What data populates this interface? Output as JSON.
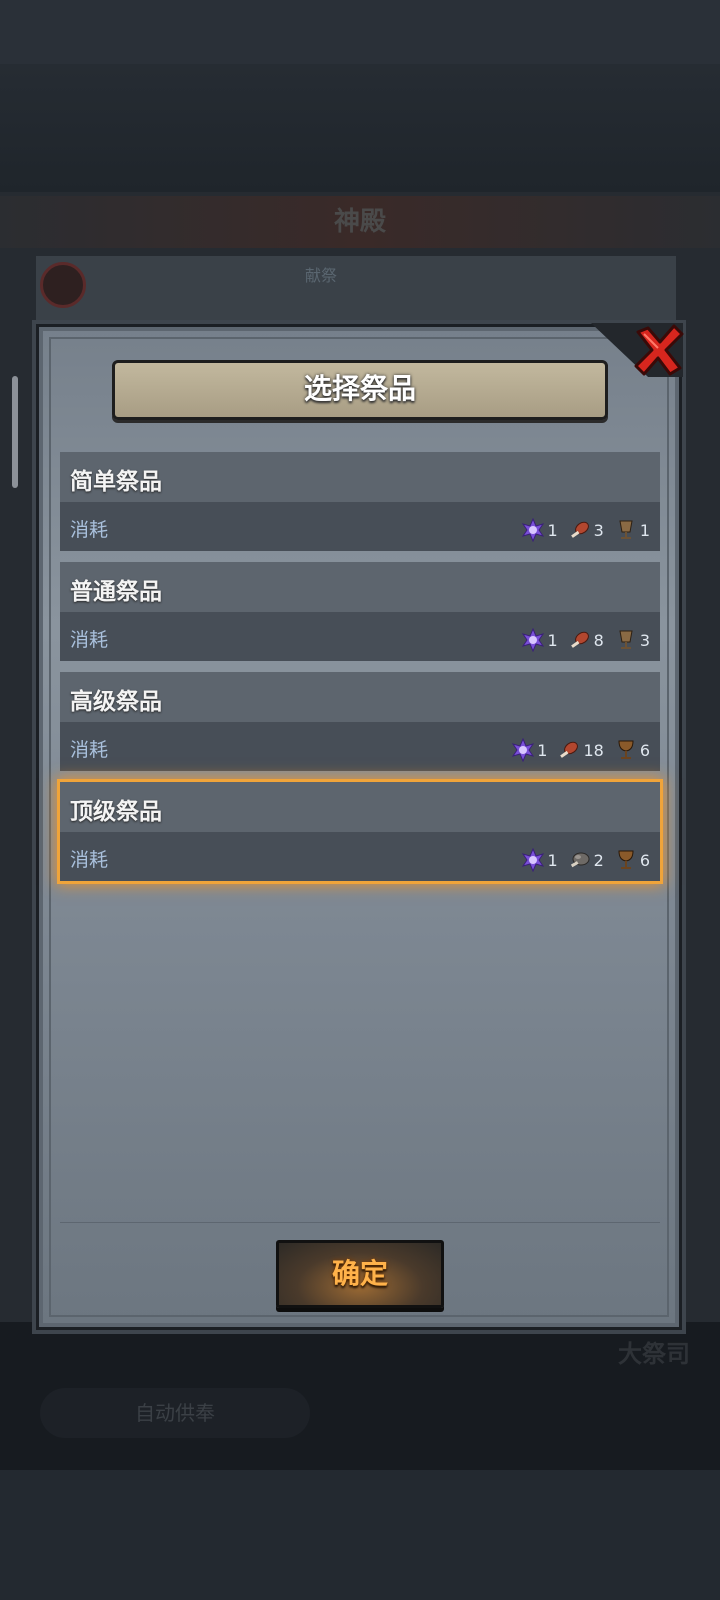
{
  "background": {
    "screen_title": "神殿",
    "card_label": "献祭",
    "auto_button": "自动供奉",
    "priest_label": "大祭司"
  },
  "dialog": {
    "title": "选择祭品",
    "confirm_label": "确定",
    "options": [
      {
        "name": "简单祭品",
        "cost_label": "消耗",
        "selected": false,
        "costs": [
          {
            "icon": "purple-crystal-icon",
            "qty": "1"
          },
          {
            "icon": "meat-leg-icon",
            "qty": "3"
          },
          {
            "icon": "wooden-cup-icon",
            "qty": "1"
          }
        ]
      },
      {
        "name": "普通祭品",
        "cost_label": "消耗",
        "selected": false,
        "costs": [
          {
            "icon": "purple-crystal-icon",
            "qty": "1"
          },
          {
            "icon": "meat-leg-icon",
            "qty": "8"
          },
          {
            "icon": "wooden-cup-icon",
            "qty": "3"
          }
        ]
      },
      {
        "name": "高级祭品",
        "cost_label": "消耗",
        "selected": false,
        "costs": [
          {
            "icon": "purple-crystal-icon",
            "qty": "1"
          },
          {
            "icon": "meat-leg-icon",
            "qty": "18"
          },
          {
            "icon": "bronze-goblet-icon",
            "qty": "6"
          }
        ]
      },
      {
        "name": "顶级祭品",
        "cost_label": "消耗",
        "selected": true,
        "costs": [
          {
            "icon": "purple-crystal-icon",
            "qty": "1"
          },
          {
            "icon": "stone-meat-icon",
            "qty": "2"
          },
          {
            "icon": "bronze-goblet-icon",
            "qty": "6"
          }
        ]
      }
    ]
  },
  "colors": {
    "highlight": "#f0a43a",
    "confirm_text": "#ffb24a",
    "cost_label": "#a9c0dc"
  }
}
